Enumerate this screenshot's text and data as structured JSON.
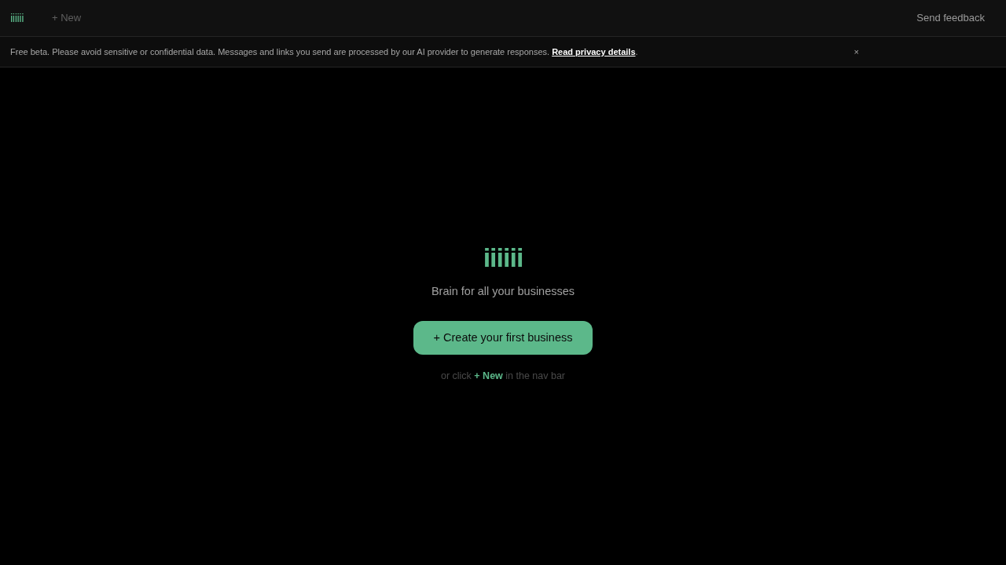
{
  "nav": {
    "logo": "iiiiii",
    "new_button": "+ New",
    "feedback_button": "Send feedback"
  },
  "banner": {
    "text": "Free beta. Please avoid sensitive or confidential data. Messages and links you send are processed by our AI provider to generate responses.",
    "link": "Read privacy details",
    "end": ".",
    "close": "×"
  },
  "hero": {
    "logo": "iiiiii",
    "tagline": "Brain for all your businesses",
    "button": "+ Create your first business",
    "hint": "or click **+ New** in the nav bar"
  }
}
